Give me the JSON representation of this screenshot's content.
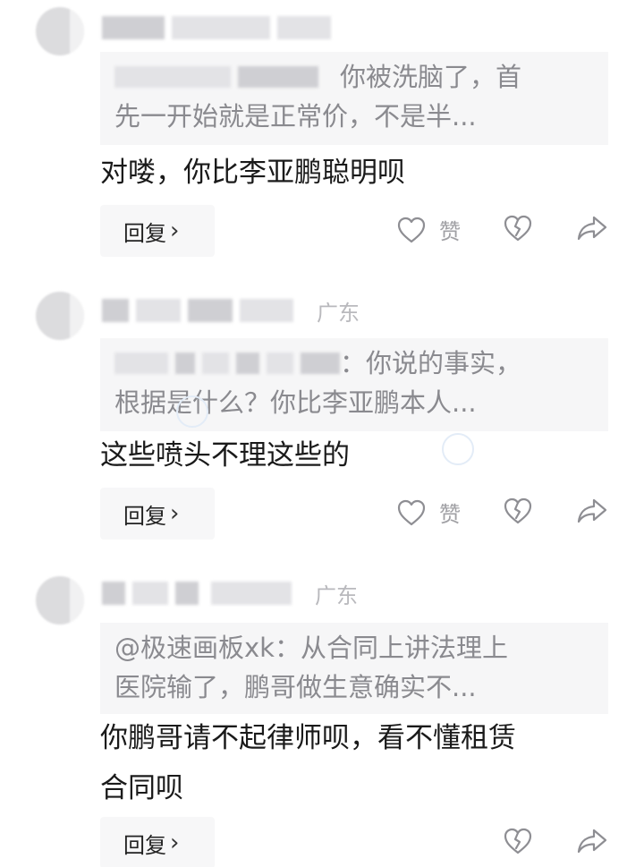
{
  "comments": [
    {
      "location": "",
      "quote_text_first": "你被洗脑了，首",
      "quote_text_second": "先一开始就是正常价，不是半...",
      "body_lines": [
        "对喽，你比李亚鹏聪明呗"
      ],
      "reply_label": "回复",
      "like_label": "赞"
    },
    {
      "location": "广东",
      "quote_text_first": "：你说的事实，",
      "quote_text_second": "根据是什么？你比李亚鹏本人...",
      "body_lines": [
        "这些喷头不理这些的"
      ],
      "reply_label": "回复",
      "like_label": "赞"
    },
    {
      "location": "广东",
      "quote_text_first": "@极速画板xk：从合同上讲法理上",
      "quote_text_second": "医院输了，鹏哥做生意确实不...",
      "body_lines": [
        "你鹏哥请不起律师呗，看不懂租赁",
        "合同呗"
      ],
      "reply_label": "回复"
    }
  ],
  "colors": {
    "quote_bg": "#f6f6f7",
    "body_text": "#1a1a1a",
    "quote_text": "#8a8a8f",
    "icon_stroke": "#8e8e93"
  },
  "icons": {
    "like": "heart-icon",
    "dislike": "broken-heart-icon",
    "share": "share-arrow-icon",
    "reply": "chevron-right-icon"
  }
}
